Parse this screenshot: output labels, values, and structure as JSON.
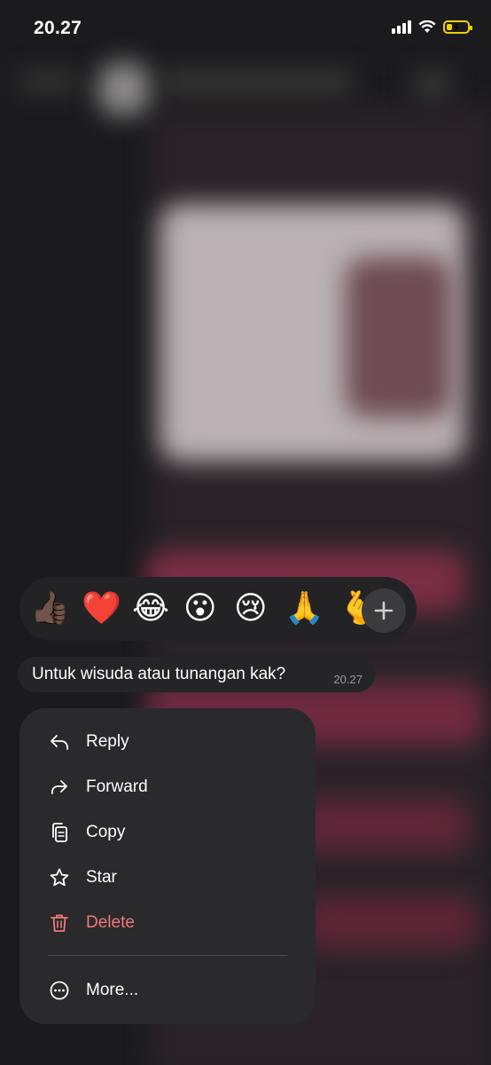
{
  "status_bar": {
    "time": "20.27"
  },
  "reactions": {
    "emojis": [
      "👍🏿",
      "❤️",
      "😂",
      "😮",
      "😢",
      "🙏",
      "🫰"
    ],
    "more_label": "+"
  },
  "message": {
    "text": "Untuk wisuda atau tunangan kak?",
    "time": "20.27"
  },
  "menu": {
    "items": [
      {
        "label": "Reply",
        "icon": "reply-icon"
      },
      {
        "label": "Forward",
        "icon": "forward-icon"
      },
      {
        "label": "Copy",
        "icon": "copy-icon"
      },
      {
        "label": "Star",
        "icon": "star-icon"
      },
      {
        "label": "Delete",
        "icon": "trash-icon"
      },
      {
        "label": "More...",
        "icon": "more-icon"
      }
    ]
  },
  "colors": {
    "delete": "#f07878",
    "battery": "#f1d000",
    "menu_bg": "#2a2a2d"
  }
}
